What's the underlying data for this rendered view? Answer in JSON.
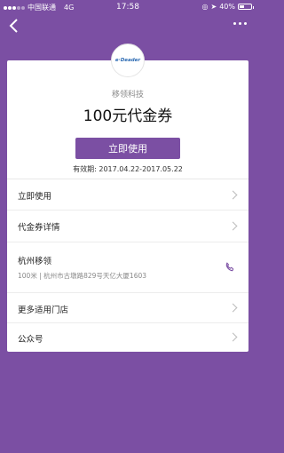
{
  "status": {
    "carrier": "中国联通",
    "network": "4G",
    "time": "17:58",
    "battery": "40%",
    "battery_level": 0.4
  },
  "card": {
    "logo_text": "e·Deader",
    "merchant": "移领科技",
    "title": "100元代金券",
    "use_button": "立即使用",
    "validity_label": "有效期:",
    "validity_value": "2017.04.22-2017.05.22"
  },
  "rows": {
    "use_now": "立即使用",
    "details": "代金券详情",
    "store_name": "杭州移领",
    "store_address": "100米 | 杭州市古墩路829号天亿大厦1603",
    "more_stores": "更多适用门店",
    "official_account": "公众号"
  },
  "colors": {
    "background": "#7b4fa3",
    "button": "#7b4fa3"
  }
}
